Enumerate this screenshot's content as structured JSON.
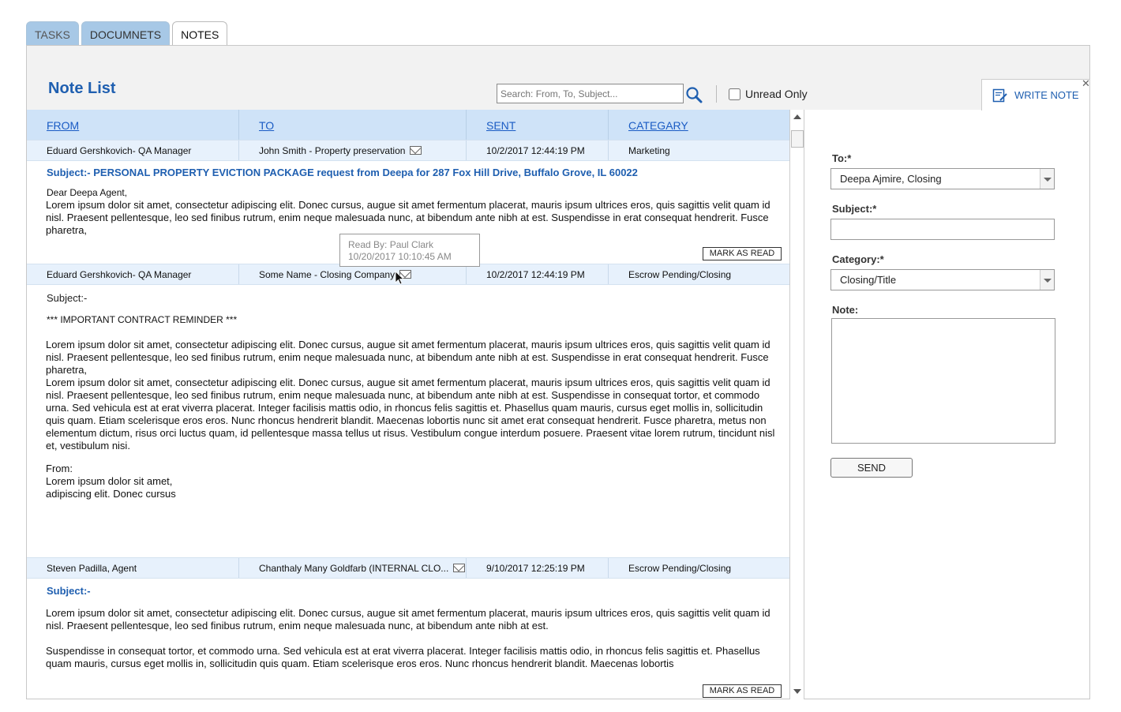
{
  "tabs": [
    {
      "label": "TASKS"
    },
    {
      "label": "DOCUMNETS"
    },
    {
      "label": "NOTES"
    }
  ],
  "header": {
    "title": "Note List",
    "search_placeholder": "Search: From, To, Subject...",
    "unread_only_label": "Unread Only",
    "unread_only_checked": false,
    "write_note_label": "WRITE NOTE",
    "close_glyph": "✕"
  },
  "columns": {
    "from": "FROM",
    "to": "TO",
    "sent": "SENT",
    "category": "CATEGARY"
  },
  "notes": [
    {
      "from": "Eduard Gershkovich- QA Manager",
      "to": "John Smith - Property preservation",
      "sent": "10/2/2017 12:44:19 PM",
      "category": "Marketing",
      "subject": "Subject:- PERSONAL PROPERTY EVICTION PACKAGE request from Deepa  for 287 Fox Hill Drive, Buffalo Grove, IL 60022",
      "greeting": "Dear Deepa Agent,",
      "body": "Lorem ipsum dolor sit amet, consectetur adipiscing elit. Donec cursus, augue sit amet fermentum placerat, mauris ipsum ultrices eros, quis sagittis velit quam id nisl. Praesent pellentesque, leo sed finibus rutrum, enim neque malesuada nunc, at bibendum ante nibh at est. Suspendisse in erat consequat hendrerit. Fusce pharetra,",
      "mark_label": "MARK AS READ"
    },
    {
      "from": "Eduard Gershkovich- QA Manager",
      "to": "Some Name - Closing Company",
      "sent": "10/2/2017 12:44:19 PM",
      "category": "Escrow Pending/Closing",
      "subject": "Subject:-",
      "reminder": "*** IMPORTANT CONTRACT REMINDER ***",
      "body1": "Lorem ipsum dolor sit amet, consectetur adipiscing elit. Donec cursus, augue sit amet fermentum placerat, mauris ipsum ultrices eros, quis sagittis velit quam id nisl. Praesent pellentesque, leo sed finibus rutrum, enim neque malesuada nunc, at bibendum ante nibh at est. Suspendisse in erat consequat hendrerit. Fusce pharetra,",
      "body2": "Lorem ipsum dolor sit amet, consectetur adipiscing elit. Donec cursus, augue sit amet fermentum placerat, mauris ipsum ultrices eros, quis sagittis velit quam id nisl. Praesent pellentesque, leo sed finibus rutrum, enim neque malesuada nunc, at bibendum ante nibh at est. Suspendisse in consequat tortor, et commodo urna. Sed vehicula est at erat viverra placerat. Integer facilisis mattis odio, in rhoncus felis sagittis et. Phasellus quam mauris, cursus eget mollis in, sollicitudin quis quam. Etiam scelerisque eros eros. Nunc rhoncus hendrerit blandit. Maecenas lobortis nunc sit amet erat consequat hendrerit. Fusce pharetra, metus non elementum dictum, risus orci luctus quam, id pellentesque massa tellus ut risus. Vestibulum congue interdum posuere. Praesent vitae lorem rutrum, tincidunt nisl et, vestibulum nisi.",
      "from_label": "From:",
      "sig1": "Lorem ipsum dolor sit amet,",
      "sig2": "adipiscing elit. Donec cursus"
    },
    {
      "from": "Steven Padilla, Agent",
      "to": "Chanthaly Many Goldfarb (INTERNAL CLO...",
      "sent": "9/10/2017 12:25:19 PM",
      "category": "Escrow Pending/Closing",
      "subject": "Subject:-",
      "body1": "Lorem ipsum dolor sit amet, consectetur adipiscing elit. Donec cursus, augue sit amet fermentum placerat, mauris ipsum ultrices eros, quis sagittis velit quam id nisl. Praesent pellentesque, leo sed finibus rutrum, enim neque malesuada nunc, at bibendum ante nibh at est.",
      "body2": "Suspendisse in consequat tortor, et commodo urna. Sed vehicula est at erat viverra placerat. Integer facilisis mattis odio, in rhoncus felis sagittis et. Phasellus quam mauris, cursus eget mollis in, sollicitudin quis quam. Etiam scelerisque eros eros. Nunc rhoncus hendrerit blandit. Maecenas lobortis",
      "mark_label": "MARK AS READ"
    }
  ],
  "tooltip": {
    "line1": "Read By: Paul Clark",
    "line2": "10/20/2017  10:10:45 AM"
  },
  "form": {
    "to_label": "To:*",
    "to_value": "Deepa Ajmire, Closing",
    "subject_label": "Subject:*",
    "subject_value": "",
    "category_label": "Category:*",
    "category_value": "Closing/Title",
    "note_label": "Note:",
    "note_value": "",
    "send_label": "SEND"
  },
  "colors": {
    "accent": "#1f5fb0",
    "tab_inactive": "#a7c8e6",
    "column_header": "#cfe3f8",
    "row_meta": "#e7f1fc"
  }
}
